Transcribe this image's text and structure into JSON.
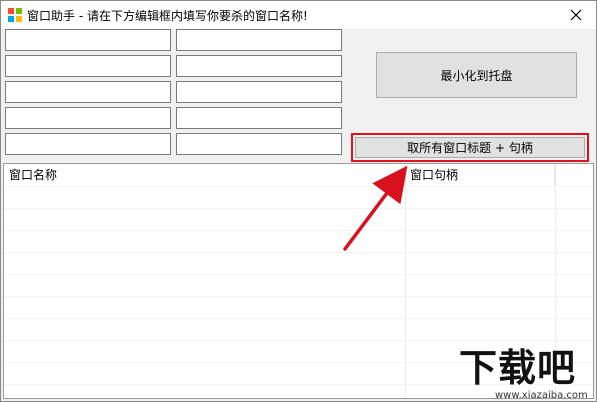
{
  "window": {
    "title": "窗口助手 - 请在下方编辑框内填写你要杀的窗口名称!",
    "close_glyph": "✕"
  },
  "inputs": [
    {
      "value": ""
    },
    {
      "value": ""
    },
    {
      "value": ""
    },
    {
      "value": ""
    },
    {
      "value": ""
    },
    {
      "value": ""
    },
    {
      "value": ""
    },
    {
      "value": ""
    },
    {
      "value": ""
    },
    {
      "value": ""
    }
  ],
  "buttons": {
    "minimize_tray": "最小化到托盘",
    "get_titles": "取所有窗口标题 + 句柄"
  },
  "list": {
    "columns": [
      "窗口名称",
      "窗口句柄"
    ]
  },
  "watermark": {
    "brand": "下载吧",
    "url": "www.xiazaiba.com"
  },
  "colors": {
    "highlight": "#e0121e",
    "arrow": "#d8121c"
  }
}
